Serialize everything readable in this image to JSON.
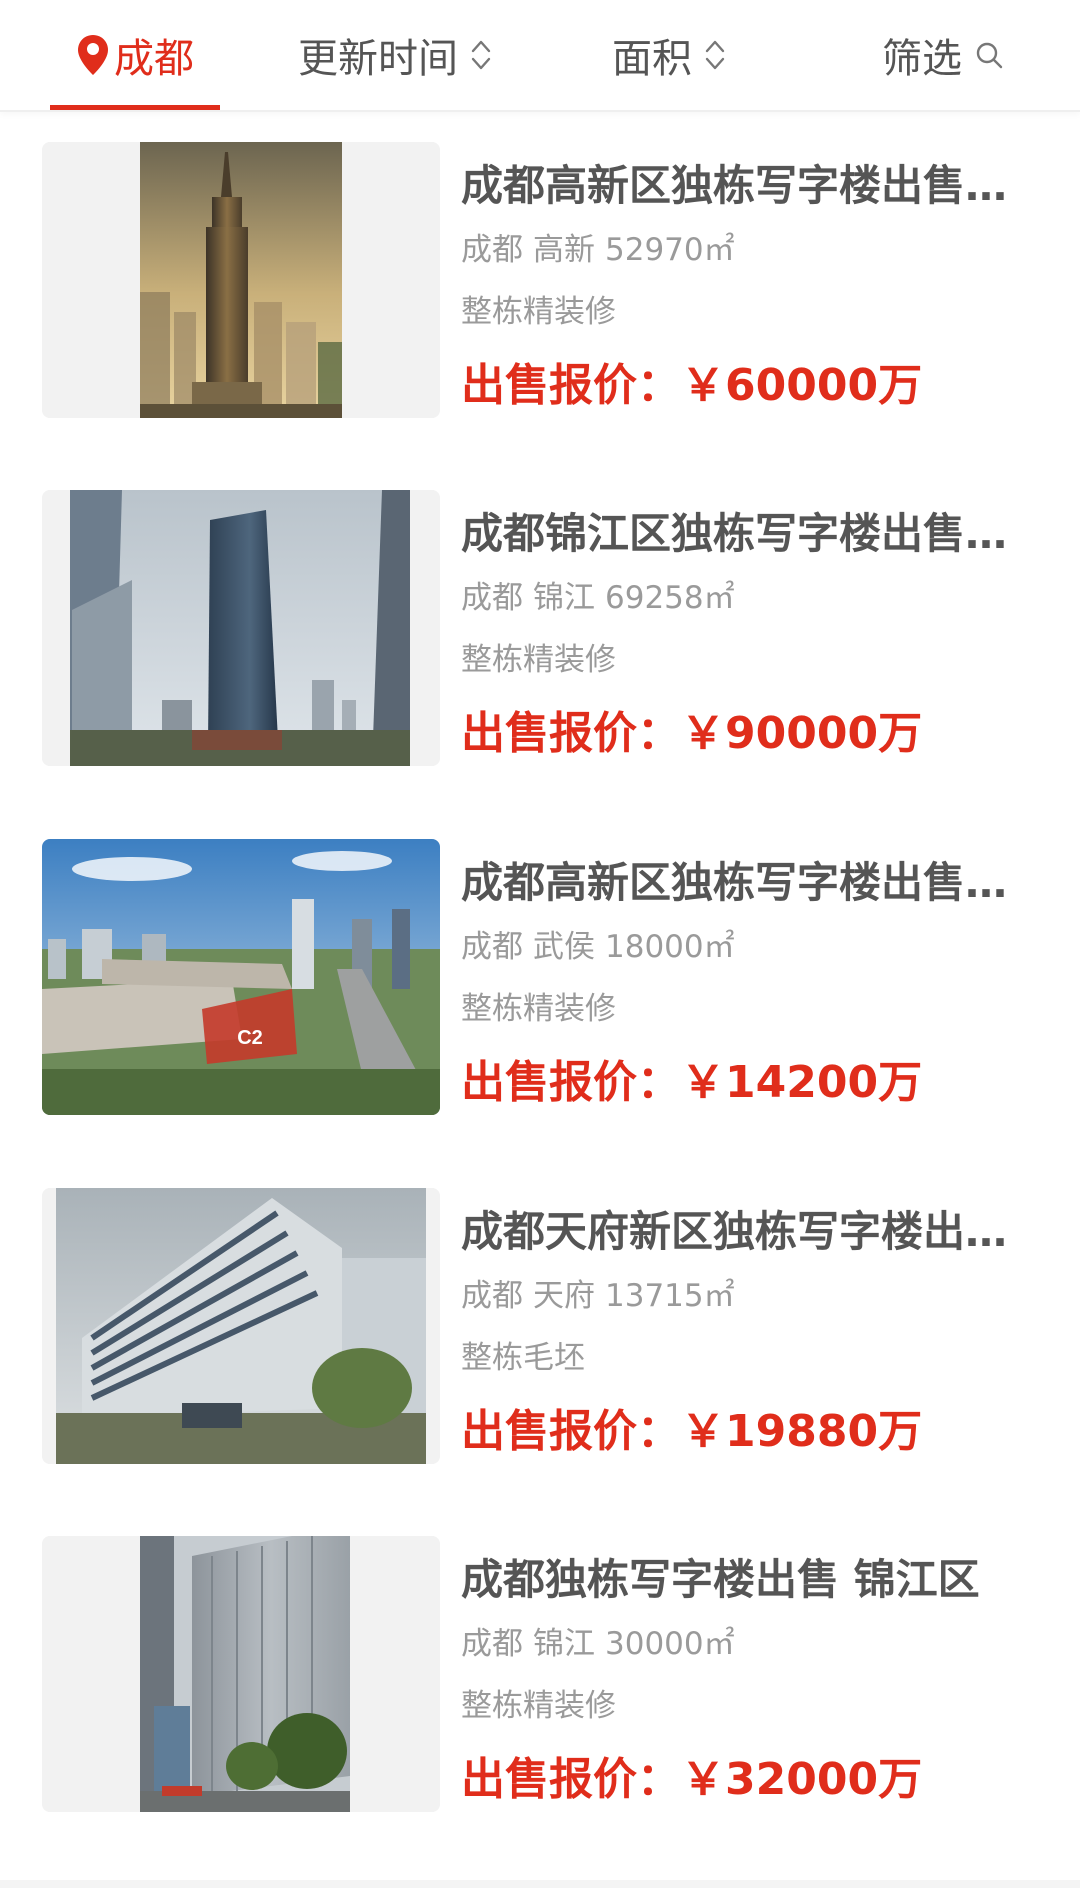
{
  "filters": {
    "city": "成都",
    "time": "更新时间",
    "area": "面积",
    "more": "筛选"
  },
  "listings": [
    {
      "title": "成都高新区独栋写字楼出售 高新",
      "city": "成都",
      "district": "高新",
      "area": "52970㎡",
      "type": "整栋",
      "decoration": "精装修",
      "price_label": "出售报价：",
      "price": "￥60000万"
    },
    {
      "title": "成都锦江区独栋写字楼出售 锦江",
      "city": "成都",
      "district": "锦江",
      "area": "69258㎡",
      "type": "整栋",
      "decoration": "精装修",
      "price_label": "出售报价：",
      "price": "￥90000万"
    },
    {
      "title": "成都高新区独栋写字楼出售 武侯",
      "city": "成都",
      "district": "武侯",
      "area": "18000㎡",
      "type": "整栋",
      "decoration": "精装修",
      "price_label": "出售报价：",
      "price": "￥14200万",
      "image_label": "C2"
    },
    {
      "title": "成都天府新区独栋写字楼出售 天府",
      "city": "成都",
      "district": "天府",
      "area": "13715㎡",
      "type": "整栋",
      "decoration": "毛坯",
      "price_label": "出售报价：",
      "price": "￥19880万"
    },
    {
      "title": "成都独栋写字楼出售 锦江区",
      "city": "成都",
      "district": "锦江",
      "area": "30000㎡",
      "type": "整栋",
      "decoration": "精装修",
      "price_label": "出售报价：",
      "price": "￥32000万"
    }
  ],
  "colors": {
    "accent": "#e02d1b",
    "title_text": "#555555",
    "meta_text": "#9a9a9a"
  }
}
